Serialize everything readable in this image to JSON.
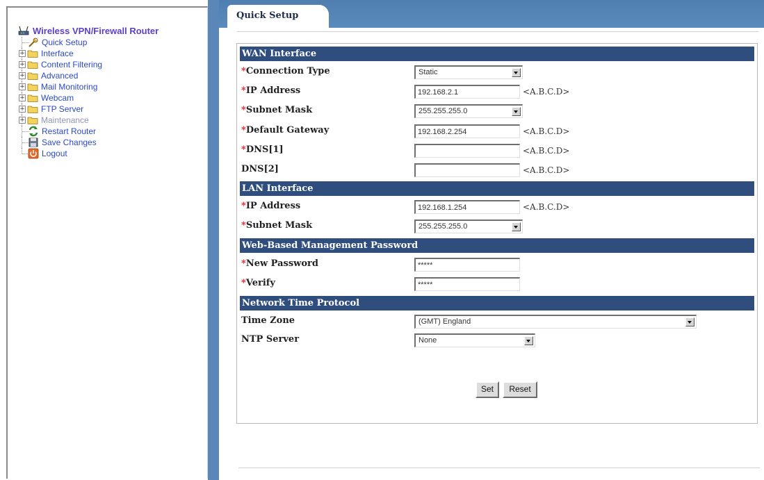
{
  "sidebar": {
    "root_label": "Wireless VPN/Firewall Router",
    "items": [
      {
        "label": "Quick Setup",
        "icon": "wrench-icon"
      },
      {
        "label": "Interface",
        "icon": "folder-icon"
      },
      {
        "label": "Content Filtering",
        "icon": "folder-icon"
      },
      {
        "label": "Advanced",
        "icon": "folder-icon"
      },
      {
        "label": "Mail Monitoring",
        "icon": "folder-icon"
      },
      {
        "label": "Webcam",
        "icon": "folder-icon"
      },
      {
        "label": "FTP Server",
        "icon": "folder-icon"
      },
      {
        "label": "Maintenance",
        "icon": "folder-icon"
      },
      {
        "label": "Restart Router",
        "icon": "restart-icon"
      },
      {
        "label": "Save Changes",
        "icon": "save-icon"
      },
      {
        "label": "Logout",
        "icon": "power-icon"
      }
    ]
  },
  "tab": {
    "label": "Quick Setup"
  },
  "wan": {
    "header": "WAN Interface",
    "connection_type": {
      "label": "Connection Type",
      "value": "Static"
    },
    "ip_address": {
      "label": "IP Address",
      "value": "192.168.2.1"
    },
    "subnet_mask": {
      "label": "Subnet Mask",
      "value": "255.255.255.0"
    },
    "default_gateway": {
      "label": "Default Gateway",
      "value": "192.168.2.254"
    },
    "dns1": {
      "label": "DNS[1]",
      "value": ""
    },
    "dns2": {
      "label": "DNS[2]",
      "value": ""
    }
  },
  "lan": {
    "header": "LAN Interface",
    "ip_address": {
      "label": "IP Address",
      "value": "192.168.1.254"
    },
    "subnet_mask": {
      "label": "Subnet Mask",
      "value": "255.255.255.0"
    }
  },
  "password": {
    "header": "Web-Based Management Password",
    "new_password": {
      "label": "New Password",
      "value": "*****"
    },
    "verify": {
      "label": "Verify",
      "value": "*****"
    }
  },
  "ntp": {
    "header": "Network Time Protocol",
    "time_zone": {
      "label": "Time Zone",
      "value": "(GMT) England"
    },
    "ntp_server": {
      "label": "NTP Server",
      "value": "None"
    }
  },
  "hint_abcd": "<A.B.C.D>",
  "required_marker": "*",
  "buttons": {
    "set": "Set",
    "reset": "Reset"
  },
  "colors": {
    "section_header": "#2f4e7d",
    "frame_bar": "#5a87b8",
    "required": "#e4202a",
    "nav_link": "#2b49c9"
  }
}
